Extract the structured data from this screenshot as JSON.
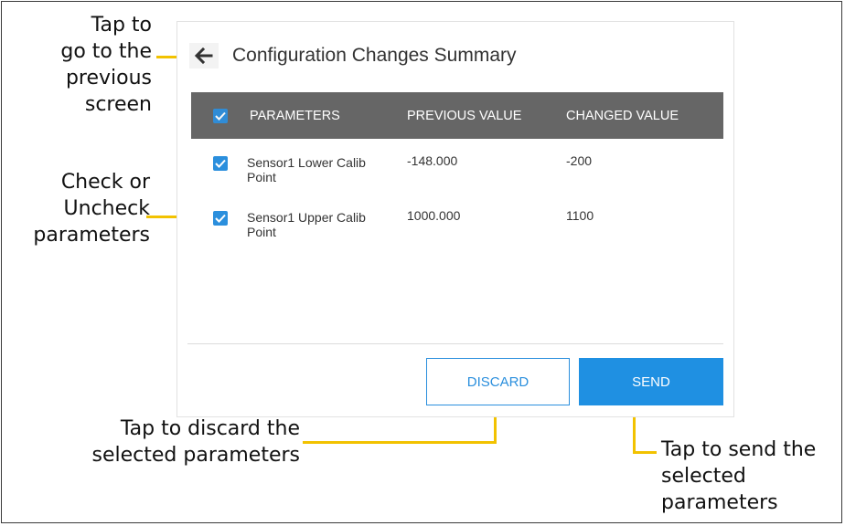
{
  "screen": {
    "title": "Configuration Changes Summary",
    "back_icon": "arrow-left-icon"
  },
  "table": {
    "headers": [
      "PARAMETERS",
      "PREVIOUS VALUE",
      "CHANGED VALUE"
    ],
    "header_checked": true,
    "rows": [
      {
        "checked": true,
        "parameter_line1": "Sensor1 Lower Calib",
        "parameter_line2": "Point",
        "previous": "-148.000",
        "changed": "-200"
      },
      {
        "checked": true,
        "parameter_line1": "Sensor1 Upper Calib",
        "parameter_line2": "Point",
        "previous": "1000.000",
        "changed": "1100"
      }
    ]
  },
  "buttons": {
    "discard": "DISCARD",
    "send": "SEND"
  },
  "annotations": {
    "back": [
      "Tap to",
      "go to the",
      "previous",
      "screen"
    ],
    "check": [
      "Check or",
      "Uncheck",
      "parameters"
    ],
    "discard": [
      "Tap to discard the",
      "selected parameters"
    ],
    "send": [
      "Tap to send the",
      "selected",
      "parameters"
    ]
  },
  "colors": {
    "accent": "#1f90e2",
    "header_bg": "#666666",
    "callout": "#f2c200"
  }
}
